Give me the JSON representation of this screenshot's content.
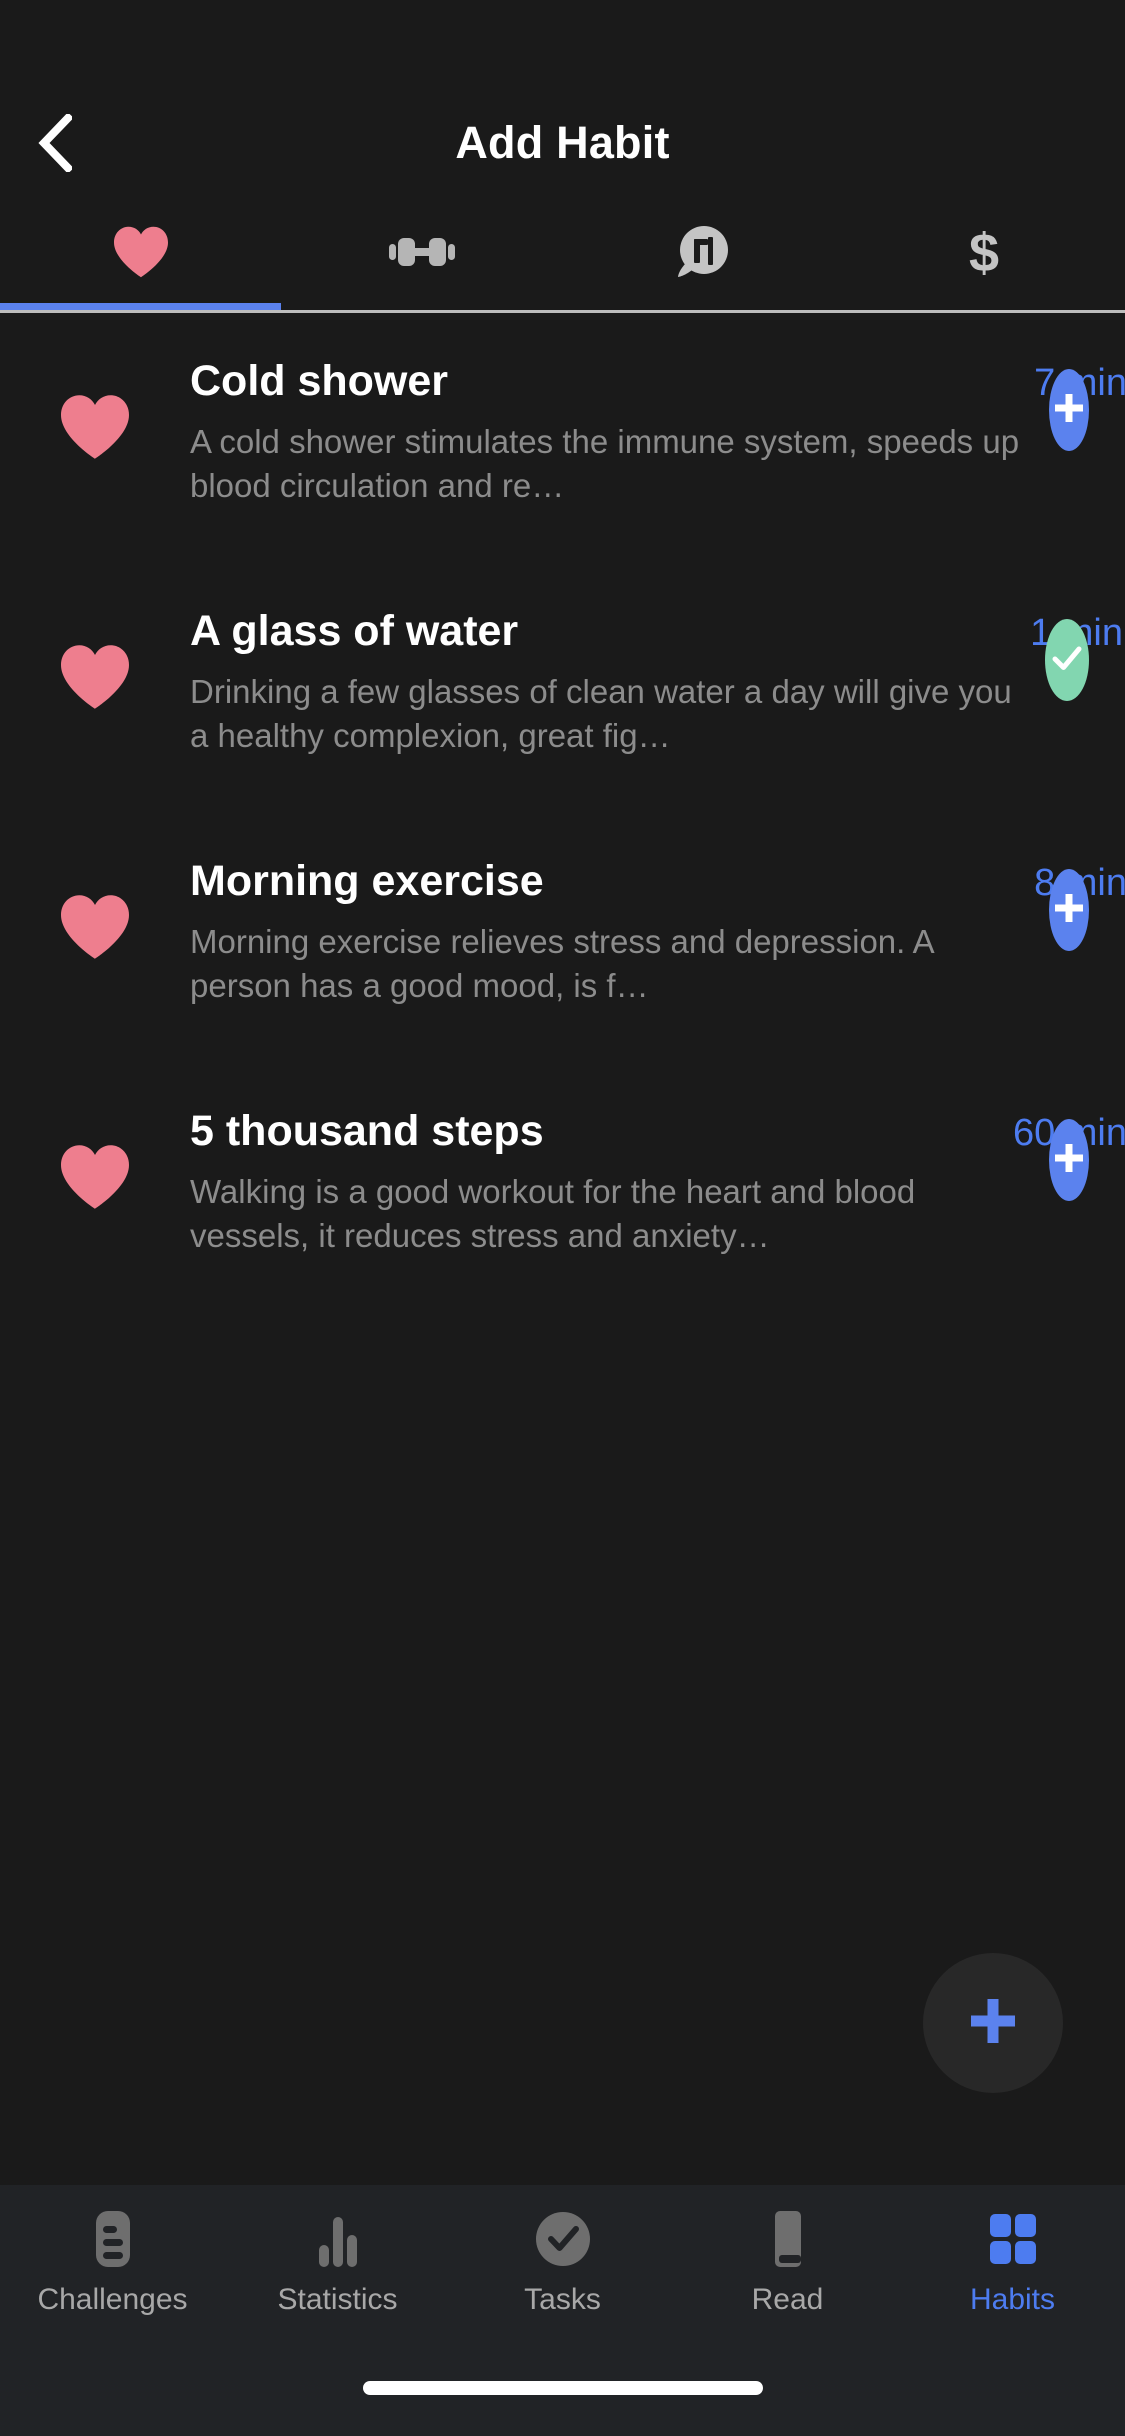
{
  "header": {
    "title": "Add Habit",
    "back_icon": "chevron-left-icon"
  },
  "category_tabs": {
    "active_index": 0,
    "accent_color": "#5b82ee",
    "items": [
      {
        "id": "health",
        "icon": "heart-icon",
        "color": "#ee7e8e",
        "active": true
      },
      {
        "id": "fitness",
        "icon": "dumbbell-icon",
        "color": "#b5b5b5",
        "active": false
      },
      {
        "id": "language",
        "icon": "speech-bubble-korean-icon",
        "color": "#c4c4c4",
        "active": false
      },
      {
        "id": "finance",
        "icon": "dollar-sign-icon",
        "color": "#c4c4c4",
        "active": false
      }
    ]
  },
  "habits": [
    {
      "icon": "heart-icon",
      "title": "Cold shower",
      "duration": "7 min",
      "description": "A cold shower stimulates the immune system, speeds up blood circulation and re…",
      "action": "add",
      "action_icon": "plus-icon"
    },
    {
      "icon": "heart-icon",
      "title": "A glass of water",
      "duration": "1 min",
      "description": "Drinking a few glasses of clean water a day will give you a healthy complexion, great fig…",
      "action": "done",
      "action_icon": "check-icon"
    },
    {
      "icon": "heart-icon",
      "title": "Morning exercise",
      "duration": "8 min",
      "description": "Morning exercise relieves stress and depression. A person has a good mood, is f…",
      "action": "add",
      "action_icon": "plus-icon"
    },
    {
      "icon": "heart-icon",
      "title": "5 thousand steps",
      "duration": "60 min",
      "description": "Walking is a good workout for the heart and blood vessels, it reduces stress and anxiety…",
      "action": "add",
      "action_icon": "plus-icon"
    }
  ],
  "fab": {
    "icon": "plus-icon",
    "color": "#5b82ee"
  },
  "bottom_nav": {
    "active_index": 4,
    "active_color": "#4d7cf0",
    "items": [
      {
        "label": "Challenges",
        "icon": "list-card-icon",
        "active": false
      },
      {
        "label": "Statistics",
        "icon": "bar-chart-icon",
        "active": false
      },
      {
        "label": "Tasks",
        "icon": "check-circle-icon",
        "active": false
      },
      {
        "label": "Read",
        "icon": "book-icon",
        "active": false
      },
      {
        "label": "Habits",
        "icon": "grid-icon",
        "active": true
      }
    ]
  },
  "colors": {
    "background": "#1a1a1a",
    "nav_background": "#212326",
    "accent_blue": "#5b82ee",
    "duration_blue": "#4d7cf0",
    "heart_pink": "#ee7e8e",
    "done_green": "#82d6b0",
    "title_white": "#ffffff",
    "description_gray": "#8c8c8c"
  }
}
